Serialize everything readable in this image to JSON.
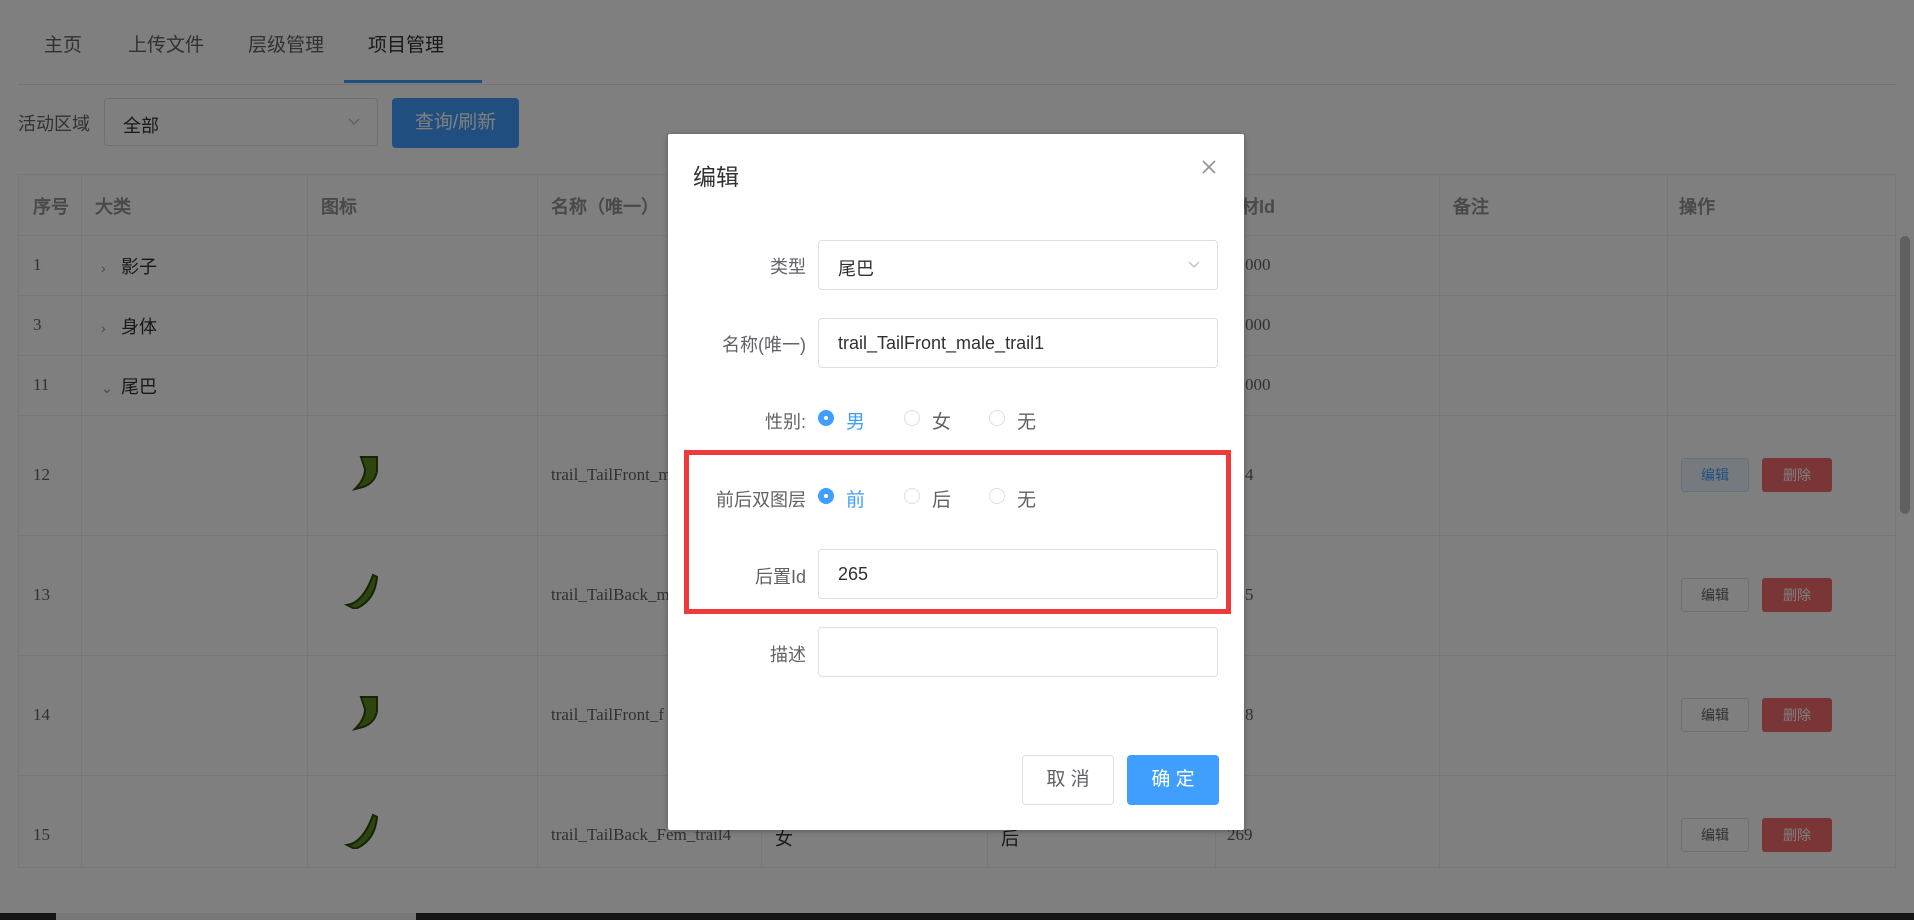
{
  "tabs": [
    {
      "label": "主页"
    },
    {
      "label": "上传文件"
    },
    {
      "label": "层级管理"
    },
    {
      "label": "项目管理"
    }
  ],
  "filter": {
    "label": "活动区域",
    "value": "全部",
    "query_button": "查询/刷新"
  },
  "table": {
    "headers": [
      "序号",
      "大类",
      "图标",
      "名称（唯一）",
      "材Id",
      "备注",
      "操作"
    ],
    "rows": [
      {
        "no": "1",
        "category": "影子",
        "expand": "›",
        "matid": "000"
      },
      {
        "no": "3",
        "category": "身体",
        "expand": "›",
        "matid": "000"
      },
      {
        "no": "11",
        "category": "尾巴",
        "expand": "⌄",
        "matid": "000"
      },
      {
        "no": "12",
        "name": "trail_TailFront_m",
        "matid": "4",
        "edit": "编辑",
        "delete": "删除"
      },
      {
        "no": "13",
        "name": "trail_TailBack_m",
        "matid": "5",
        "edit": "编辑",
        "delete": "删除"
      },
      {
        "no": "14",
        "name": "trail_TailFront_f",
        "matid": "8",
        "edit": "编辑",
        "delete": "删除"
      },
      {
        "no": "15",
        "name": "trail_TailBack_Fem_trail4",
        "gender": "女",
        "layer": "后",
        "matid": "269",
        "edit": "编辑",
        "delete": "删除"
      }
    ]
  },
  "dialog": {
    "title": "编辑",
    "type_label": "类型",
    "type_value": "尾巴",
    "name_label": "名称(唯一)",
    "name_value": "trail_TailFront_male_trail1",
    "gender_label": "性别:",
    "gender_options": [
      "男",
      "女",
      "无"
    ],
    "gender_selected": "男",
    "layer_label": "前后双图层",
    "layer_options": [
      "前",
      "后",
      "无"
    ],
    "layer_selected": "前",
    "back_id_label": "后置Id",
    "back_id_value": "265",
    "desc_label": "描述",
    "desc_value": "",
    "cancel": "取 消",
    "confirm": "确 定"
  },
  "colors": {
    "primary": "#409eff",
    "danger": "#f56c6c",
    "highlight": "#ee3a3a",
    "icon_green": "#5a8a1e"
  },
  "icons": [
    "chevron-down-icon",
    "close-icon",
    "tail-icon",
    "chevron-right-icon"
  ]
}
